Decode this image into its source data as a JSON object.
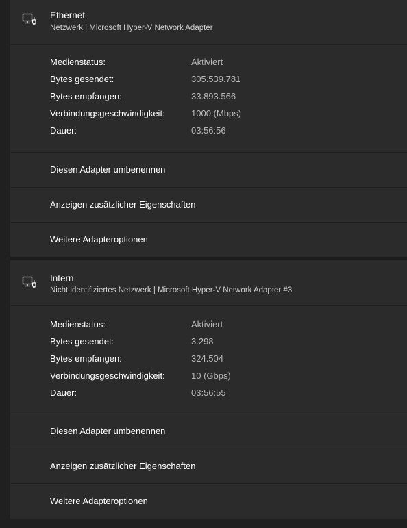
{
  "adapters": [
    {
      "name": "Ethernet",
      "subtitle": "Netzwerk | Microsoft Hyper-V Network Adapter",
      "icon": "network-adapter-icon",
      "properties": [
        {
          "label": "Medienstatus:",
          "value": "Aktiviert"
        },
        {
          "label": "Bytes gesendet:",
          "value": "305.539.781"
        },
        {
          "label": "Bytes empfangen:",
          "value": "33.893.566"
        },
        {
          "label": "Verbindungsgeschwindigkeit:",
          "value": "1000 (Mbps)"
        },
        {
          "label": "Dauer:",
          "value": "03:56:56"
        }
      ],
      "actions": [
        {
          "label": "Diesen Adapter umbenennen"
        },
        {
          "label": "Anzeigen zusätzlicher Eigenschaften"
        },
        {
          "label": "Weitere Adapteroptionen"
        }
      ]
    },
    {
      "name": "Intern",
      "subtitle": "Nicht identifiziertes Netzwerk | Microsoft Hyper-V Network Adapter #3",
      "icon": "network-adapter-icon",
      "properties": [
        {
          "label": "Medienstatus:",
          "value": "Aktiviert"
        },
        {
          "label": "Bytes gesendet:",
          "value": "3.298"
        },
        {
          "label": "Bytes empfangen:",
          "value": "324.504"
        },
        {
          "label": "Verbindungsgeschwindigkeit:",
          "value": "10 (Gbps)"
        },
        {
          "label": "Dauer:",
          "value": "03:56:55"
        }
      ],
      "actions": [
        {
          "label": "Diesen Adapter umbenennen"
        },
        {
          "label": "Anzeigen zusätzlicher Eigenschaften"
        },
        {
          "label": "Weitere Adapteroptionen"
        }
      ]
    }
  ]
}
